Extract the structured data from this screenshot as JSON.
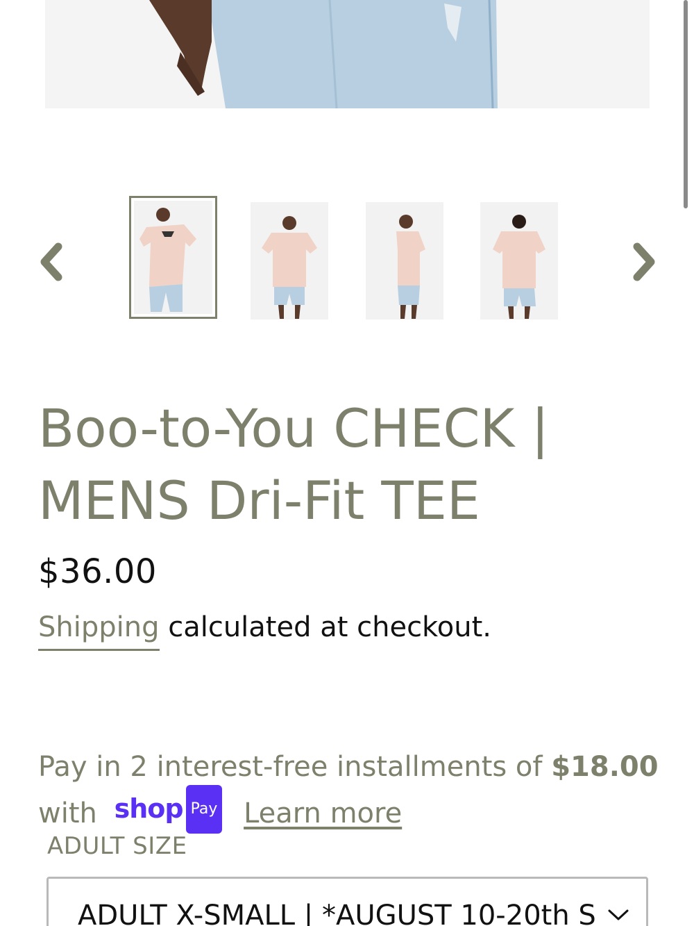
{
  "product": {
    "title": "Boo-to-You CHECK | MENS Dri-Fit TEE",
    "price": "$36.00"
  },
  "shipping": {
    "link_label": "Shipping",
    "suffix": "calculated at checkout."
  },
  "installments": {
    "prefix": "Pay in 2 interest-free installments of",
    "amount": "$18.00",
    "with": "with",
    "shop_word": "shop",
    "pay_badge": "Pay",
    "learn_more": "Learn more"
  },
  "size": {
    "label": "ADULT SIZE",
    "selected": "ADULT X-SMALL | *AUGUST 10-20th S"
  },
  "gallery": {
    "prev_icon": "chevron-left-icon",
    "next_icon": "chevron-right-icon",
    "thumbnails": [
      "front-pose-1",
      "front-pose-2",
      "side-pose",
      "back-pose"
    ]
  },
  "colors": {
    "accent": "#7d806b",
    "shop_pay": "#5a31f4",
    "text": "#111111"
  }
}
